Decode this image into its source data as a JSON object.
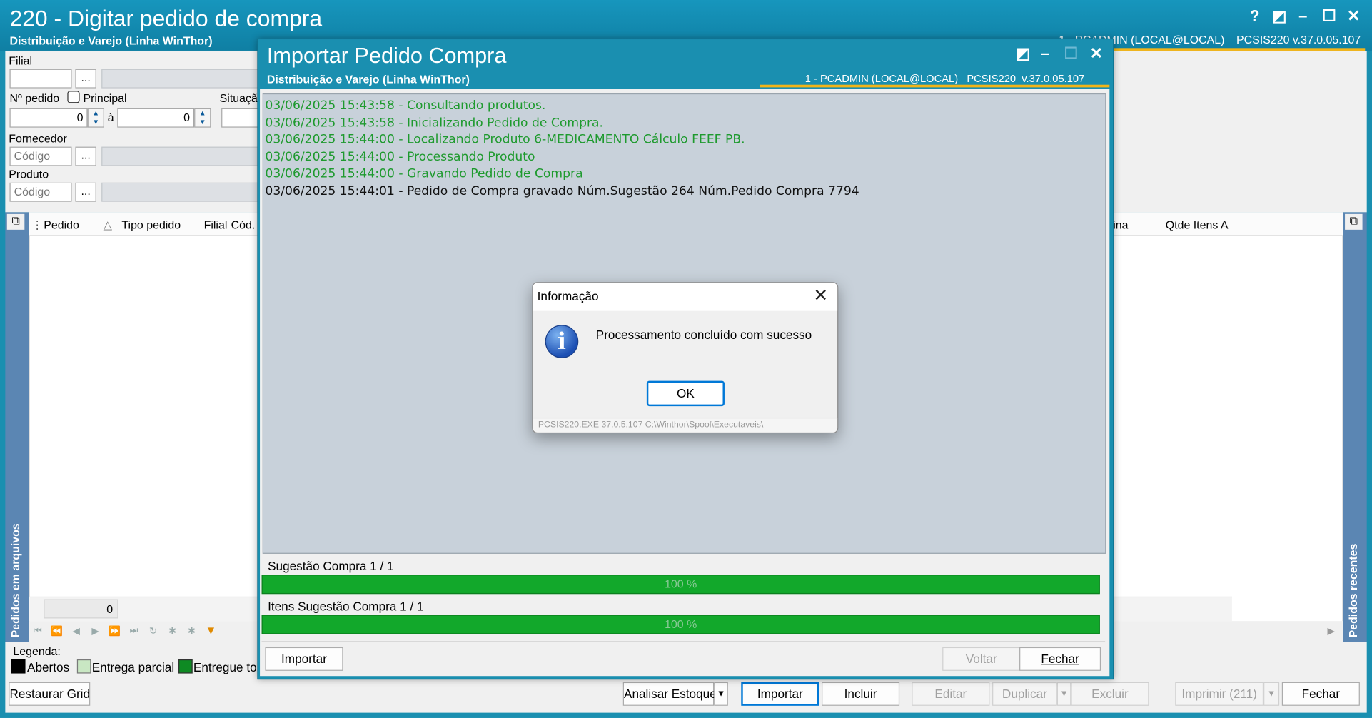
{
  "main": {
    "title": "220 - Digitar pedido de compra",
    "subtitle": "Distribuição e Varejo (Linha WinThor)",
    "user_info": "1 - PCADMIN (LOCAL@LOCAL)",
    "version_info": "PCSIS220  v.37.0.05.107",
    "ctrls": {
      "help": "?",
      "restore": "◩",
      "min": "–",
      "max": "☐",
      "close": "✕"
    }
  },
  "filters": {
    "filial_label": "Filial",
    "filial_value": "",
    "dots": "...",
    "npedido_label": "Nº pedido",
    "principal_label": "Principal",
    "situacao_label": "Situaçã",
    "from_value": "0",
    "to_label": "à",
    "to_value": "0",
    "fornecedor_label": "Fornecedor",
    "fornecedor_placeholder": "Código",
    "produto_label": "Produto",
    "produto_placeholder": "Código"
  },
  "grid": {
    "columns": [
      "Pedido",
      "Tipo pedido",
      "Filial",
      "Cód."
    ],
    "right_columns": [
      "ina",
      "Qtde Itens A"
    ],
    "footer_value": "0"
  },
  "side": {
    "left_label": "Pedidos em arquivos",
    "right_label": "Pedidos recentes"
  },
  "legend": {
    "title": "Legenda:",
    "items": [
      {
        "label": "Abertos",
        "color": "#000000"
      },
      {
        "label": "Entrega parcial",
        "color": "#c9e7c3"
      },
      {
        "label": "Entregue to",
        "color": "#0e8a23"
      }
    ]
  },
  "bottom": {
    "restaurar": "Restaurar Grid",
    "analisar": "Analisar Estoque",
    "importar": "Importar",
    "incluir": "Incluir",
    "editar": "Editar",
    "duplicar": "Duplicar",
    "excluir": "Excluir",
    "imprimir": "Imprimir (211)",
    "fechar": "Fechar"
  },
  "import_dialog": {
    "title": "Importar Pedido Compra",
    "subtitle": "Distribuição e Varejo (Linha WinThor)",
    "info": "1 - PCADMIN (LOCAL@LOCAL)   PCSIS220  v.37.0.05.107",
    "log": [
      {
        "text": "03/06/2025 15:43:58 - Consultando produtos.",
        "color": "#1e9a2e"
      },
      {
        "text": "03/06/2025 15:43:58 - Inicializando Pedido de Compra.",
        "color": "#1e9a2e"
      },
      {
        "text": "03/06/2025 15:44:00 - Localizando Produto 6-MEDICAMENTO Cálculo FEEF PB.",
        "color": "#1e9a2e"
      },
      {
        "text": "03/06/2025 15:44:00 - Processando Produto",
        "color": "#1e9a2e"
      },
      {
        "text": "03/06/2025 15:44:00 - Gravando Pedido de Compra",
        "color": "#1e9a2e"
      },
      {
        "text": "03/06/2025 15:44:01 - Pedido de Compra gravado Núm.Sugestão 264 Núm.Pedido Compra 7794",
        "color": "#111111"
      }
    ],
    "progress1": {
      "label": "Sugestão Compra 1 / 1",
      "value_text": "100 %",
      "percent": 100
    },
    "progress2": {
      "label": "Itens Sugestão Compra 1 / 1",
      "value_text": "100 %",
      "percent": 100
    },
    "btn_importar": "Importar",
    "btn_voltar": "Voltar",
    "btn_fechar": "Fechar"
  },
  "message_box": {
    "title": "Informação",
    "text": "Processamento concluído com sucesso",
    "ok": "OK",
    "status": "PCSIS220.EXE 37.0.5.107 C:\\Winthor\\Spool\\Executaveis\\"
  }
}
